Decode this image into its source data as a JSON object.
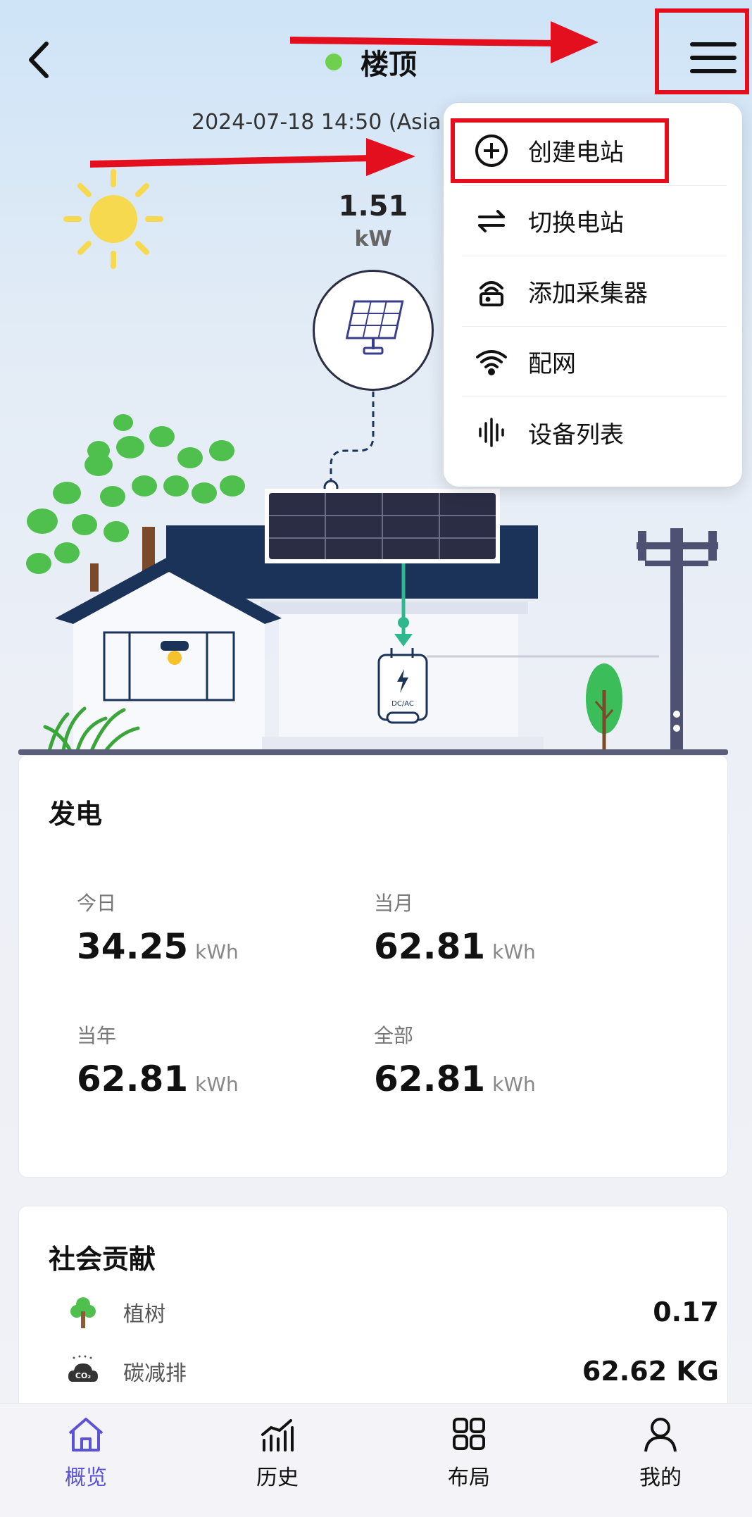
{
  "header": {
    "title": "楼顶",
    "timestamp": "2024-07-18 14:50 (Asia",
    "status_color": "#6fd04e"
  },
  "power": {
    "value": "1.51",
    "unit": "kW"
  },
  "menu": {
    "items": [
      {
        "label": "创建电站",
        "icon": "plus-circle-icon"
      },
      {
        "label": "切换电站",
        "icon": "switch-arrows-icon"
      },
      {
        "label": "添加采集器",
        "icon": "router-icon"
      },
      {
        "label": "配网",
        "icon": "wifi-icon"
      },
      {
        "label": "设备列表",
        "icon": "soundwave-icon"
      }
    ]
  },
  "generation": {
    "title": "发电",
    "stats": [
      {
        "label": "今日",
        "value": "34.25",
        "unit": "kWh"
      },
      {
        "label": "当月",
        "value": "62.81",
        "unit": "kWh"
      },
      {
        "label": "当年",
        "value": "62.81",
        "unit": "kWh"
      },
      {
        "label": "全部",
        "value": "62.81",
        "unit": "kWh"
      }
    ]
  },
  "social": {
    "title": "社会贡献",
    "rows": [
      {
        "label": "植树",
        "value": "0.17",
        "icon": "tree-icon"
      },
      {
        "label": "碳减排",
        "value": "62.62 KG",
        "icon": "co2-cloud-icon"
      }
    ]
  },
  "illustration": {
    "inverter_label": "DC/AC"
  },
  "nav": {
    "items": [
      {
        "label": "概览",
        "icon": "home-icon",
        "active": true
      },
      {
        "label": "历史",
        "icon": "bar-chart-icon",
        "active": false
      },
      {
        "label": "布局",
        "icon": "grid-icon",
        "active": false
      },
      {
        "label": "我的",
        "icon": "user-icon",
        "active": false
      }
    ]
  },
  "colors": {
    "accent": "#5b54d6",
    "annotation_red": "#e30f1e",
    "roof_navy": "#1b3358",
    "pipe_green": "#2fb88e"
  }
}
